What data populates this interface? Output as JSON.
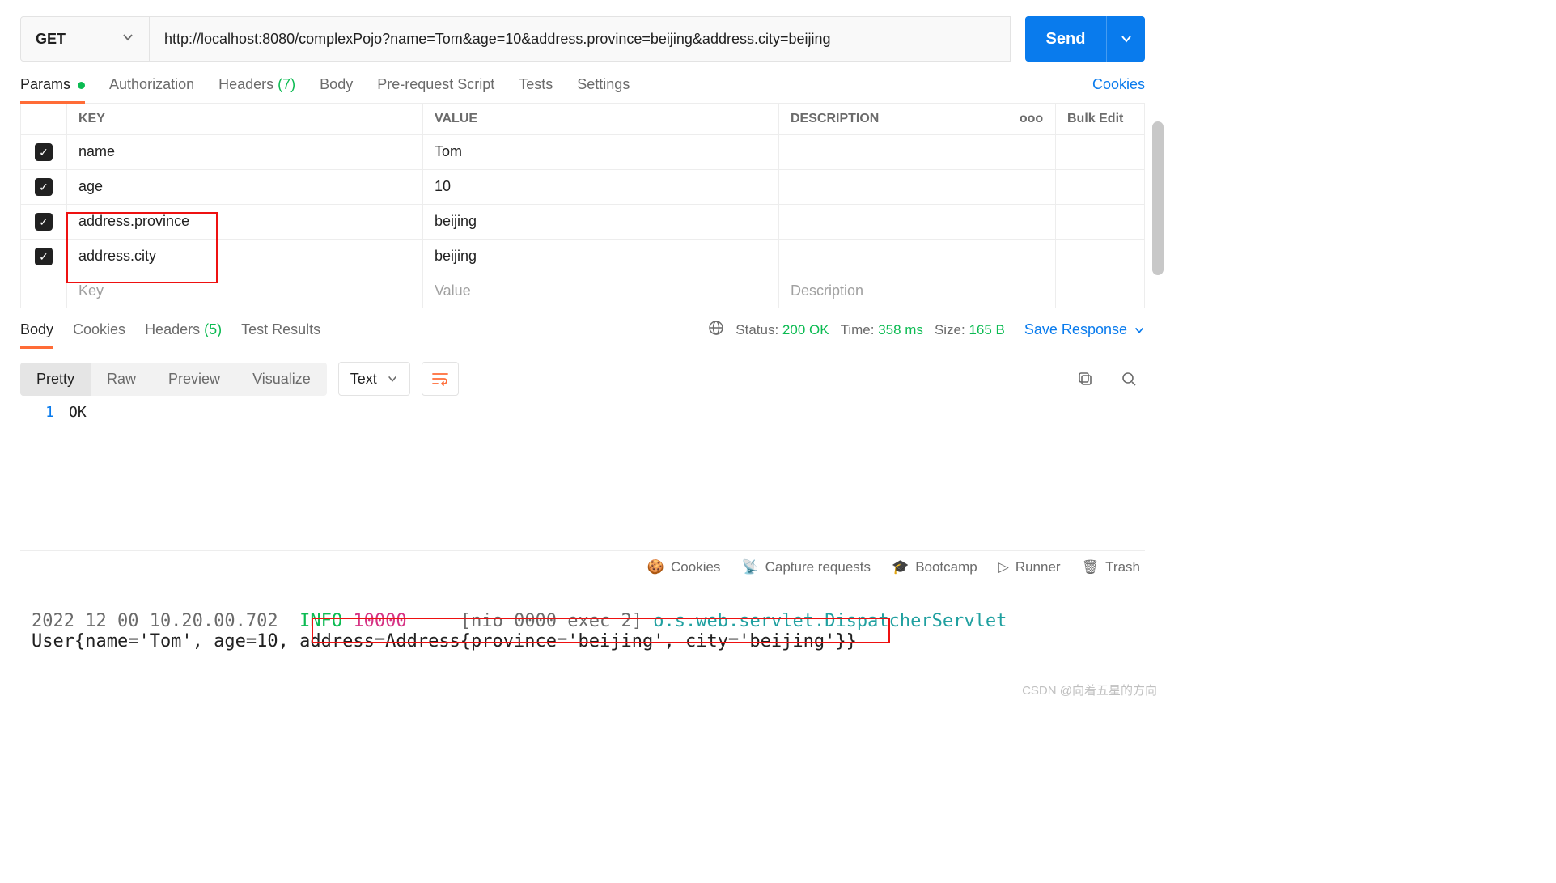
{
  "request": {
    "method": "GET",
    "url": "http://localhost:8080/complexPojo?name=Tom&age=10&address.province=beijing&address.city=beijing",
    "send_label": "Send"
  },
  "tabs": {
    "params": "Params",
    "authorization": "Authorization",
    "headers_label": "Headers",
    "headers_count": "(7)",
    "body": "Body",
    "prerequest": "Pre-request Script",
    "tests": "Tests",
    "settings": "Settings",
    "cookies": "Cookies"
  },
  "params_table": {
    "header_key": "KEY",
    "header_value": "VALUE",
    "header_desc": "DESCRIPTION",
    "bulk_edit": "Bulk Edit",
    "more": "ooo",
    "rows": [
      {
        "key": "name",
        "value": "Tom",
        "desc": ""
      },
      {
        "key": "age",
        "value": "10",
        "desc": ""
      },
      {
        "key": "address.province",
        "value": "beijing",
        "desc": ""
      },
      {
        "key": "address.city",
        "value": "beijing",
        "desc": ""
      }
    ],
    "placeholder_key": "Key",
    "placeholder_value": "Value",
    "placeholder_desc": "Description"
  },
  "response_tabs": {
    "body": "Body",
    "cookies": "Cookies",
    "headers_label": "Headers",
    "headers_count": "(5)",
    "test_results": "Test Results",
    "save_response": "Save Response"
  },
  "response_meta": {
    "status_label": "Status:",
    "status_value": "200 OK",
    "time_label": "Time:",
    "time_value": "358 ms",
    "size_label": "Size:",
    "size_value": "165 B"
  },
  "response_view": {
    "pretty": "Pretty",
    "raw": "Raw",
    "preview": "Preview",
    "visualize": "Visualize",
    "format": "Text"
  },
  "response_body": {
    "line_no": "1",
    "content": "OK"
  },
  "statusbar": {
    "cookies": "Cookies",
    "capture": "Capture requests",
    "bootcamp": "Bootcamp",
    "runner": "Runner",
    "trash": "Trash"
  },
  "console": {
    "line1_ts": "2022 12 00 10.20.00.702",
    "line1_lvl": "INFO",
    "line1_pid": "10000",
    "line1_thr": "[nio 0000 exec 2]",
    "line1_cls": "o.s.web.servlet.DispatcherServlet",
    "line2": "User{name='Tom', age=10, address=Address{province='beijing', city='beijing'}}"
  },
  "watermark": "CSDN @向着五星的方向"
}
